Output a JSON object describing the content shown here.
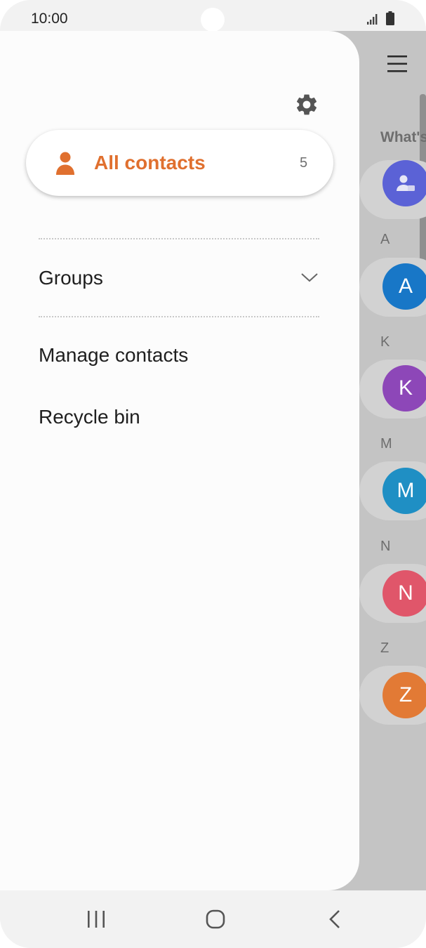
{
  "status_bar": {
    "time": "10:00",
    "icons": [
      "signal-icon",
      "battery-icon"
    ]
  },
  "background": {
    "menu_icon": "hamburger-menu-icon",
    "whats_label": "What's",
    "index": [
      {
        "letter": "A",
        "avatar": "A",
        "color": "#1877c7"
      },
      {
        "letter": "K",
        "avatar": "K",
        "color": "#8d47b8"
      },
      {
        "letter": "M",
        "avatar": "M",
        "color": "#1f8fc4"
      },
      {
        "letter": "N",
        "avatar": "N",
        "color": "#e0566a"
      },
      {
        "letter": "Z",
        "avatar": "Z",
        "color": "#e27a35"
      }
    ],
    "first_avatar_color": "#5b62d6"
  },
  "drawer": {
    "settings_icon": "gear-icon",
    "all_contacts": {
      "label": "All contacts",
      "count": "5",
      "icon": "person-icon",
      "accent": "#e0702f"
    },
    "groups": {
      "label": "Groups",
      "icon": "chevron-down-icon"
    },
    "items": [
      {
        "label": "Manage contacts"
      },
      {
        "label": "Recycle bin"
      }
    ]
  },
  "nav_bar": {
    "buttons": [
      "recent-apps-icon",
      "home-icon",
      "back-icon"
    ]
  }
}
